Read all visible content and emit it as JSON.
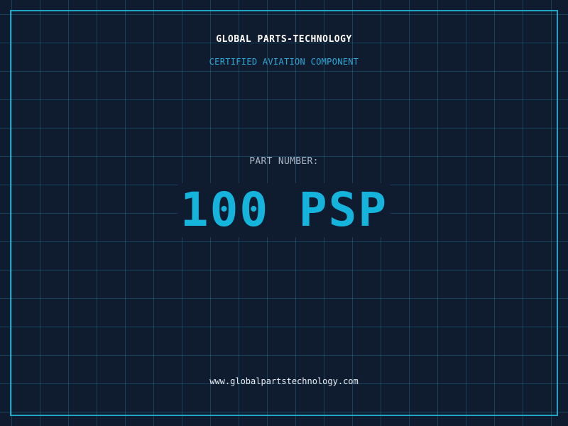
{
  "header": {
    "company_name": "GLOBAL PARTS-TECHNOLOGY",
    "tagline": "CERTIFIED AVIATION COMPONENT"
  },
  "part": {
    "label": "PART NUMBER:",
    "number": "100 PSP"
  },
  "footer": {
    "website": "www.globalpartstechnology.com"
  },
  "colors": {
    "background": "#0f1b2e",
    "grid": "#2882a0",
    "frame": "#1fa6c9",
    "accent": "#15b4dc",
    "tagline": "#2aa8d8"
  }
}
